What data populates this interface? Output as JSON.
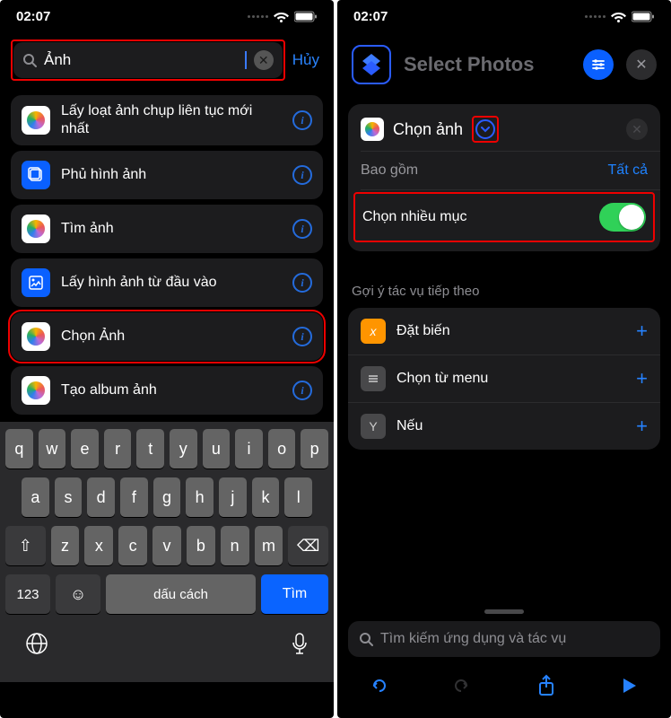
{
  "left": {
    "status_time": "02:07",
    "search_value": "Ảnh",
    "cancel": "Hủy",
    "items": [
      "Lấy loạt ảnh chụp liên tục mới nhất",
      "Phủ hình ảnh",
      "Tìm ảnh",
      "Lấy hình ảnh từ đầu vào",
      "Chọn Ảnh",
      "Tạo album ảnh"
    ],
    "keyboard": {
      "row1": [
        "q",
        "w",
        "e",
        "r",
        "t",
        "y",
        "u",
        "i",
        "o",
        "p"
      ],
      "row2": [
        "a",
        "s",
        "d",
        "f",
        "g",
        "h",
        "j",
        "k",
        "l"
      ],
      "row3_shift": "⇧",
      "row3": [
        "z",
        "x",
        "c",
        "v",
        "b",
        "n",
        "m"
      ],
      "row3_bs": "⌫",
      "numkey": "123",
      "emoji": "☺",
      "space": "dấu cách",
      "search": "Tìm"
    }
  },
  "right": {
    "status_time": "02:07",
    "title": "Select Photos",
    "card": {
      "title": "Chọn ảnh",
      "include_label": "Bao gồm",
      "include_value": "Tất cả",
      "multi_label": "Chọn nhiều mục"
    },
    "suggest_title": "Gợi ý tác vụ tiếp theo",
    "suggestions": [
      "Đặt biến",
      "Chọn từ menu",
      "Nếu"
    ],
    "footer_placeholder": "Tìm kiếm ứng dụng và tác vụ"
  }
}
